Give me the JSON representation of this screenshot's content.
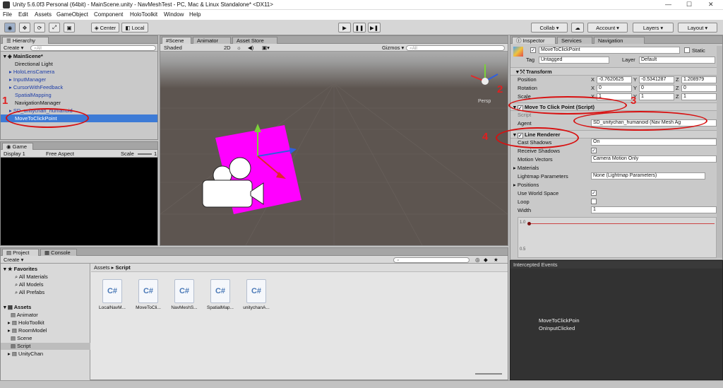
{
  "window": {
    "title": "Unity 5.6.0f3 Personal (64bit) - MainScene.unity - NavMeshTest - PC, Mac & Linux Standalone* <DX11>"
  },
  "menu": [
    "File",
    "Edit",
    "Assets",
    "GameObject",
    "Component",
    "HoloToolkit",
    "Window",
    "Help"
  ],
  "toolbar": {
    "center": "Center",
    "local": "Local",
    "collab": "Collab ▾",
    "account": "Account",
    "layers": "Layers",
    "layout": "Layout"
  },
  "hierarchy": {
    "tab": "Hierarchy",
    "create": "Create ▾",
    "search_placeholder": "All",
    "scene": "MainScene*",
    "items": [
      {
        "label": "Directional Light"
      },
      {
        "label": "HoloLensCamera"
      },
      {
        "label": "InputManager"
      },
      {
        "label": "CursorWithFeedback"
      },
      {
        "label": "SpatialMapping"
      },
      {
        "label": "NavigationManager"
      },
      {
        "label": "SD_unitychan_humanoid"
      },
      {
        "label": "MoveToClickPoint"
      }
    ]
  },
  "game": {
    "tab": "Game",
    "display": "Display 1",
    "aspect": "Free Aspect",
    "scale": "Scale",
    "scale_val": "1"
  },
  "scene": {
    "tabs": [
      "Scene",
      "Animator",
      "Asset Store"
    ],
    "shaded": "Shaded",
    "mode2d": "2D",
    "gizmos": "Gizmos ▾",
    "search_placeholder": "All",
    "persp": "Persp"
  },
  "inspector": {
    "tabs": [
      "Inspector",
      "Services",
      "Navigation"
    ],
    "object_name": "MoveToClickPoint",
    "static": "Static",
    "tag_label": "Tag",
    "tag_value": "Untagged",
    "layer_label": "Layer",
    "layer_value": "Default",
    "transform": {
      "header": "Transform",
      "position_label": "Position",
      "position": [
        "-0.7620625",
        "-0.5341287",
        "1.208979"
      ],
      "rotation_label": "Rotation",
      "rotation": [
        "0",
        "0",
        "0"
      ],
      "scale_label": "Scale",
      "scale": [
        "1",
        "1",
        "1"
      ]
    },
    "script_comp": {
      "header": "Move To Click Point (Script)",
      "script_label": "Script",
      "agent_label": "Agent",
      "agent_value": "SD_unitychan_humanoid (Nav Mesh Ag"
    },
    "line_renderer": {
      "header": "Line Renderer",
      "cast_shadows_label": "Cast Shadows",
      "cast_shadows_value": "On",
      "receive_shadows_label": "Receive Shadows",
      "motion_vectors_label": "Motion Vectors",
      "motion_vectors_value": "Camera Motion Only",
      "materials_label": "Materials",
      "lightmap_label": "Lightmap Parameters",
      "lightmap_value": "None (Lightmap Parameters)",
      "positions_label": "Positions",
      "world_space_label": "Use World Space",
      "loop_label": "Loop",
      "width_label": "Width",
      "width_value": "1",
      "curve_top": "1.0",
      "curve_mid": "0.5"
    }
  },
  "intercepted": {
    "header": "Intercepted Events",
    "line1": "MoveToClickPoin",
    "line2": "OnInputClicked"
  },
  "project": {
    "tabs": [
      "Project",
      "Console"
    ],
    "create": "Create ▾",
    "breadcrumb_root": "Assets",
    "breadcrumb_leaf": "Script",
    "tree": [
      {
        "label": "Favorites",
        "bold": true
      },
      {
        "label": "All Materials"
      },
      {
        "label": "All Models"
      },
      {
        "label": "All Prefabs"
      },
      {
        "label": "Assets",
        "bold": true
      },
      {
        "label": "Animator"
      },
      {
        "label": "HoloToolkit"
      },
      {
        "label": "RoomModel"
      },
      {
        "label": "Scene"
      },
      {
        "label": "Script"
      },
      {
        "label": "UnityChan"
      }
    ],
    "assets": [
      "LocalNavM...",
      "MoveToCli...",
      "NavMeshS...",
      "SpatialMap...",
      "unitychanA..."
    ],
    "asset_glyph": "C#"
  },
  "annotations": [
    "1",
    "2",
    "3",
    "4"
  ],
  "colors": {
    "selection": "#3d7bd6",
    "annotation": "#e02020",
    "cube": "#ff00ff"
  }
}
